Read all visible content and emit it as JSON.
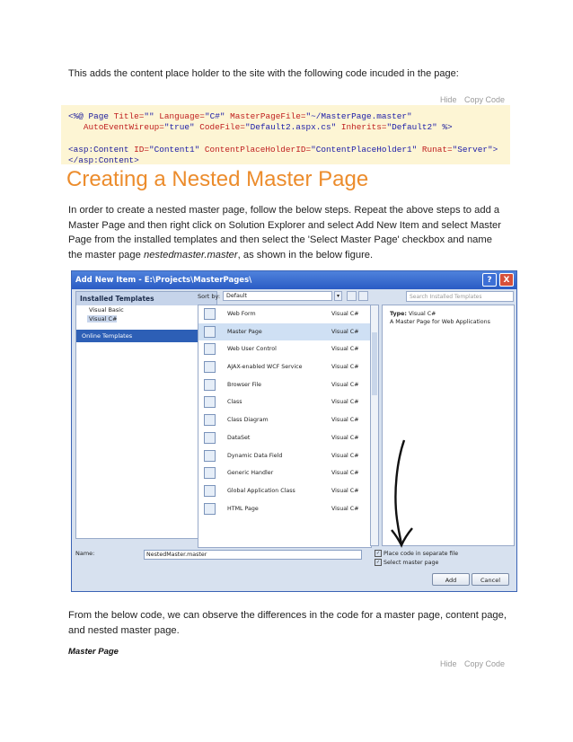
{
  "intro": "This adds the content place holder to the site with the following code incuded in the page:",
  "code_toolbar": {
    "hide": "Hide",
    "copy": "Copy Code"
  },
  "code1": {
    "l1_a": "<%@ Page ",
    "l1_b": "Title=",
    "l1_c": "\"\" ",
    "l1_d": "Language=",
    "l1_e": "\"C#\" ",
    "l1_f": "MasterPageFile=",
    "l1_g": "\"~/MasterPage.master\"",
    "l2_a": "   AutoEventWireup=",
    "l2_b": "\"true\" ",
    "l2_c": "CodeFile=",
    "l2_d": "\"Default2.aspx.cs\" ",
    "l2_e": "Inherits=",
    "l2_f": "\"Default2\" ",
    "l2_g": "%>",
    "l4_a": "<asp:Content ",
    "l4_b": "ID=",
    "l4_c": "\"Content1\" ",
    "l4_d": "ContentPlaceHolderID=",
    "l4_e": "\"ContentPlaceHolder1\" ",
    "l4_f": "Runat=",
    "l4_g": "\"Server\">",
    "l5": "</asp:Content>"
  },
  "heading": "Creating a Nested Master Page",
  "paragraph_pre": "In order to create a nested master page, follow the below steps. Repeat the above steps to add a Master Page and then right click on Solution Explorer and select Add New Item and select Master Page from the installed templates and then select the 'Select Master Page' checkbox and name the master page ",
  "paragraph_em": "nestedmaster.master",
  "paragraph_post": ", as shown in the below figure.",
  "dialog": {
    "title": "Add New Item - E:\\Projects\\MasterPages\\",
    "help": "?",
    "close": "X",
    "installed_templates": "Installed Templates",
    "visual_basic": "Visual Basic",
    "visual_csharp": "Visual C#",
    "online_templates": "Online Templates",
    "sort_by": "Sort by:",
    "sort_value": "Default",
    "search_placeholder": "Search Installed Templates",
    "items": [
      {
        "name": "Web Form",
        "lang": "Visual C#"
      },
      {
        "name": "Master Page",
        "lang": "Visual C#"
      },
      {
        "name": "Web User Control",
        "lang": "Visual C#"
      },
      {
        "name": "AJAX-enabled WCF Service",
        "lang": "Visual C#"
      },
      {
        "name": "Browser File",
        "lang": "Visual C#"
      },
      {
        "name": "Class",
        "lang": "Visual C#"
      },
      {
        "name": "Class Diagram",
        "lang": "Visual C#"
      },
      {
        "name": "DataSet",
        "lang": "Visual C#"
      },
      {
        "name": "Dynamic Data Field",
        "lang": "Visual C#"
      },
      {
        "name": "Generic Handler",
        "lang": "Visual C#"
      },
      {
        "name": "Global Application Class",
        "lang": "Visual C#"
      },
      {
        "name": "HTML Page",
        "lang": "Visual C#"
      }
    ],
    "selected_index": 1,
    "type_label": "Type:",
    "type_value": "Visual C#",
    "type_desc": "A Master Page for Web Applications",
    "name_label": "Name:",
    "name_value": "NestedMaster.master",
    "place_code": "Place code in separate file",
    "select_master": "Select master page",
    "add": "Add",
    "cancel": "Cancel"
  },
  "bottom_text": "From the below code, we can observe the differences in the code for a master page, content page, and nested master page.",
  "subheading": "Master Page"
}
